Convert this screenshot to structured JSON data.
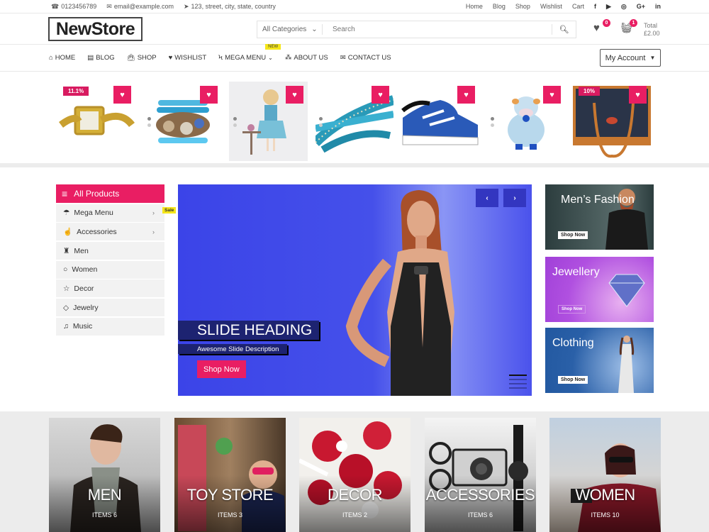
{
  "topbar": {
    "phone": "0123456789",
    "email": "email@example.com",
    "address": "123, street, city, state, country",
    "links": [
      "Home",
      "Blog",
      "Shop",
      "Wishlist",
      "Cart"
    ],
    "social": {
      "facebook": "f",
      "youtube": "▶",
      "instagram": "◎",
      "googleplus": "G+",
      "linkedin": "in"
    }
  },
  "header": {
    "logo": "NewStore",
    "category_select": "All Categories",
    "search_placeholder": "Search",
    "wishlist_count": "0",
    "cart_count": "1",
    "total_label": "Total",
    "total_value": "£2.00"
  },
  "nav": {
    "items": [
      "Home",
      "Blog",
      "Shop",
      "Wishlist",
      "Mega Menu",
      "About Us",
      "Contact Us"
    ],
    "new_badge": "NEW",
    "my_account": "My Account"
  },
  "products": [
    {
      "name": "Gold Watch",
      "discount": "11.1%"
    },
    {
      "name": "Beaded Bracelet",
      "discount": ""
    },
    {
      "name": "Doll",
      "discount": ""
    },
    {
      "name": "Studded Bracelet",
      "discount": ""
    },
    {
      "name": "Running Shoe",
      "discount": ""
    },
    {
      "name": "Plush Toy",
      "discount": ""
    },
    {
      "name": "Leather Handbag",
      "discount": "10%"
    }
  ],
  "sidebar": {
    "title": "All Products",
    "sale_badge": "Sale",
    "items": [
      {
        "label": "Mega Menu",
        "icon": "☂",
        "arrow": "›"
      },
      {
        "label": "Accessories",
        "icon": "👍",
        "arrow": "›"
      },
      {
        "label": "Men",
        "icon": "♜",
        "arrow": ""
      },
      {
        "label": "Women",
        "icon": "💬",
        "arrow": ""
      },
      {
        "label": "Decor",
        "icon": "☆",
        "arrow": ""
      },
      {
        "label": "Jewelry",
        "icon": "◇",
        "arrow": ""
      },
      {
        "label": "Music",
        "icon": "♫",
        "arrow": ""
      }
    ]
  },
  "slider": {
    "heading": "SLIDE HEADING",
    "description": "Awesome Slide Description",
    "button": "Shop Now",
    "prev": "‹",
    "next": "›"
  },
  "banners": [
    {
      "title": "Men’s Fashion",
      "button": "Shop Now"
    },
    {
      "title": "Jewellery",
      "button": "Shop Now"
    },
    {
      "title": "Clothing",
      "button": "Shop Now"
    }
  ],
  "categories": [
    {
      "name": "MEN",
      "items": "ITEMS 6"
    },
    {
      "name": "TOY STORE",
      "items": "ITEMS 3"
    },
    {
      "name": "DECOR",
      "items": "ITEMS 2"
    },
    {
      "name": "ACCESSORIES",
      "items": "ITEMS 6"
    },
    {
      "name": "WOMEN",
      "items": "ITEMS 10"
    }
  ],
  "colors": {
    "accent": "#e91e63",
    "slider_bg": "#3b44e8",
    "badge_yellow": "#f5e61a"
  }
}
